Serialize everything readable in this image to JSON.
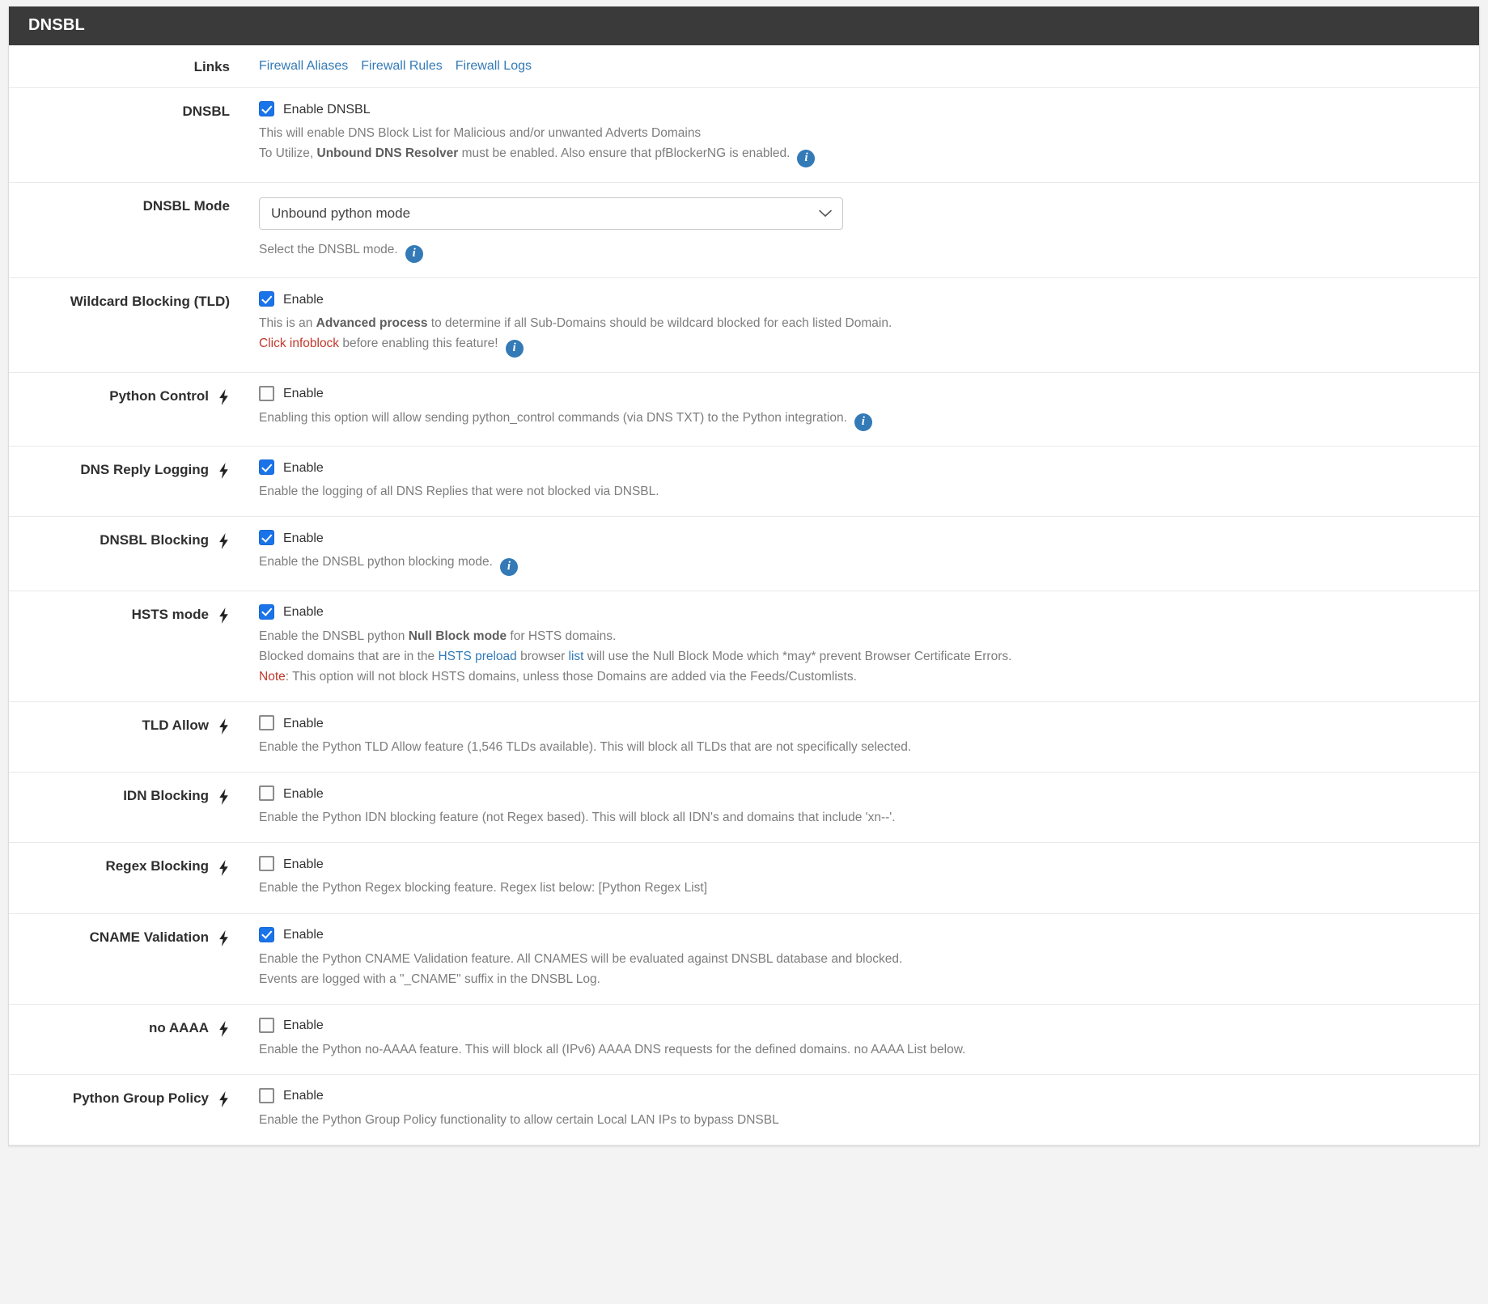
{
  "panel": {
    "title": "DNSBL"
  },
  "links": {
    "label": "Links",
    "items": [
      {
        "text": "Firewall Aliases"
      },
      {
        "text": "Firewall Rules"
      },
      {
        "text": "Firewall Logs"
      }
    ]
  },
  "colors": {
    "accent": "#337ab7",
    "checkbox_checked": "#1a73e8",
    "header_bg": "#3a3a3a",
    "note_red": "#c0392b",
    "help_text": "#7d7d7d"
  },
  "rows": {
    "dnsbl": {
      "label": "DNSBL",
      "bolt": false,
      "checkbox_label": "Enable DNSBL",
      "checked": true,
      "help_line1": "This will enable DNS Block List for Malicious and/or unwanted Adverts Domains",
      "help_line2_a": "To Utilize, ",
      "help_line2_b": "Unbound DNS Resolver",
      "help_line2_c": " must be enabled. Also ensure that pfBlockerNG is enabled.",
      "info_icon": "info-icon"
    },
    "dnsbl_mode": {
      "label": "DNSBL Mode",
      "bolt": false,
      "selected": "Unbound python mode",
      "options": [
        "Unbound python mode"
      ],
      "help": "Select the DNSBL mode.",
      "info_icon": "info-icon"
    },
    "wildcard": {
      "label": "Wildcard Blocking (TLD)",
      "bolt": false,
      "checkbox_label": "Enable",
      "checked": true,
      "help_line1_a": "This is an ",
      "help_line1_b": "Advanced process",
      "help_line1_c": " to determine if all Sub-Domains should be wildcard blocked for each listed Domain.",
      "help_line2_a": "Click infoblock",
      "help_line2_b": " before enabling this feature!",
      "info_icon": "info-icon"
    },
    "python_control": {
      "label": "Python Control",
      "bolt": true,
      "checkbox_label": "Enable",
      "checked": false,
      "help": "Enabling this option will allow sending python_control commands (via DNS TXT) to the Python integration.",
      "info_icon": "info-icon"
    },
    "dns_reply_logging": {
      "label": "DNS Reply Logging",
      "bolt": true,
      "checkbox_label": "Enable",
      "checked": true,
      "help": "Enable the logging of all DNS Replies that were not blocked via DNSBL."
    },
    "dnsbl_blocking": {
      "label": "DNSBL Blocking",
      "bolt": true,
      "checkbox_label": "Enable",
      "checked": true,
      "help": "Enable the DNSBL python blocking mode.",
      "info_icon": "info-icon"
    },
    "hsts_mode": {
      "label": "HSTS mode",
      "bolt": true,
      "checkbox_label": "Enable",
      "checked": true,
      "help_line1_a": "Enable the DNSBL python ",
      "help_line1_b": "Null Block mode",
      "help_line1_c": " for HSTS domains.",
      "help_line2_a": "Blocked domains that are in the ",
      "help_line2_link1": "HSTS preload",
      "help_line2_b": " browser ",
      "help_line2_link2": "list",
      "help_line2_c": " will use the Null Block Mode which *may* prevent Browser Certificate Errors.",
      "help_line3_a": "Note",
      "help_line3_b": ": This option will not block HSTS domains, unless those Domains are added via the Feeds/Customlists."
    },
    "tld_allow": {
      "label": "TLD Allow",
      "bolt": true,
      "checkbox_label": "Enable",
      "checked": false,
      "help": "Enable the Python TLD Allow feature (1,546 TLDs available). This will block all TLDs that are not specifically selected."
    },
    "idn_blocking": {
      "label": "IDN Blocking",
      "bolt": true,
      "checkbox_label": "Enable",
      "checked": false,
      "help": "Enable the Python IDN blocking feature (not Regex based). This will block all IDN's and domains that include 'xn--'."
    },
    "regex_blocking": {
      "label": "Regex Blocking",
      "bolt": true,
      "checkbox_label": "Enable",
      "checked": false,
      "help": "Enable the Python Regex blocking feature. Regex list below: [Python Regex List]"
    },
    "cname_validation": {
      "label": "CNAME Validation",
      "bolt": true,
      "checkbox_label": "Enable",
      "checked": true,
      "help_line1": "Enable the Python CNAME Validation feature. All CNAMES will be evaluated against DNSBL database and blocked.",
      "help_line2": "Events are logged with a \"_CNAME\" suffix in the DNSBL Log."
    },
    "no_aaaa": {
      "label": "no AAAA",
      "bolt": true,
      "checkbox_label": "Enable",
      "checked": false,
      "help": "Enable the Python no-AAAA feature. This will block all (IPv6) AAAA DNS requests for the defined domains. no AAAA List below."
    },
    "python_group_policy": {
      "label": "Python Group Policy",
      "bolt": true,
      "checkbox_label": "Enable",
      "checked": false,
      "help": "Enable the Python Group Policy functionality to allow certain Local LAN IPs to bypass DNSBL"
    }
  }
}
